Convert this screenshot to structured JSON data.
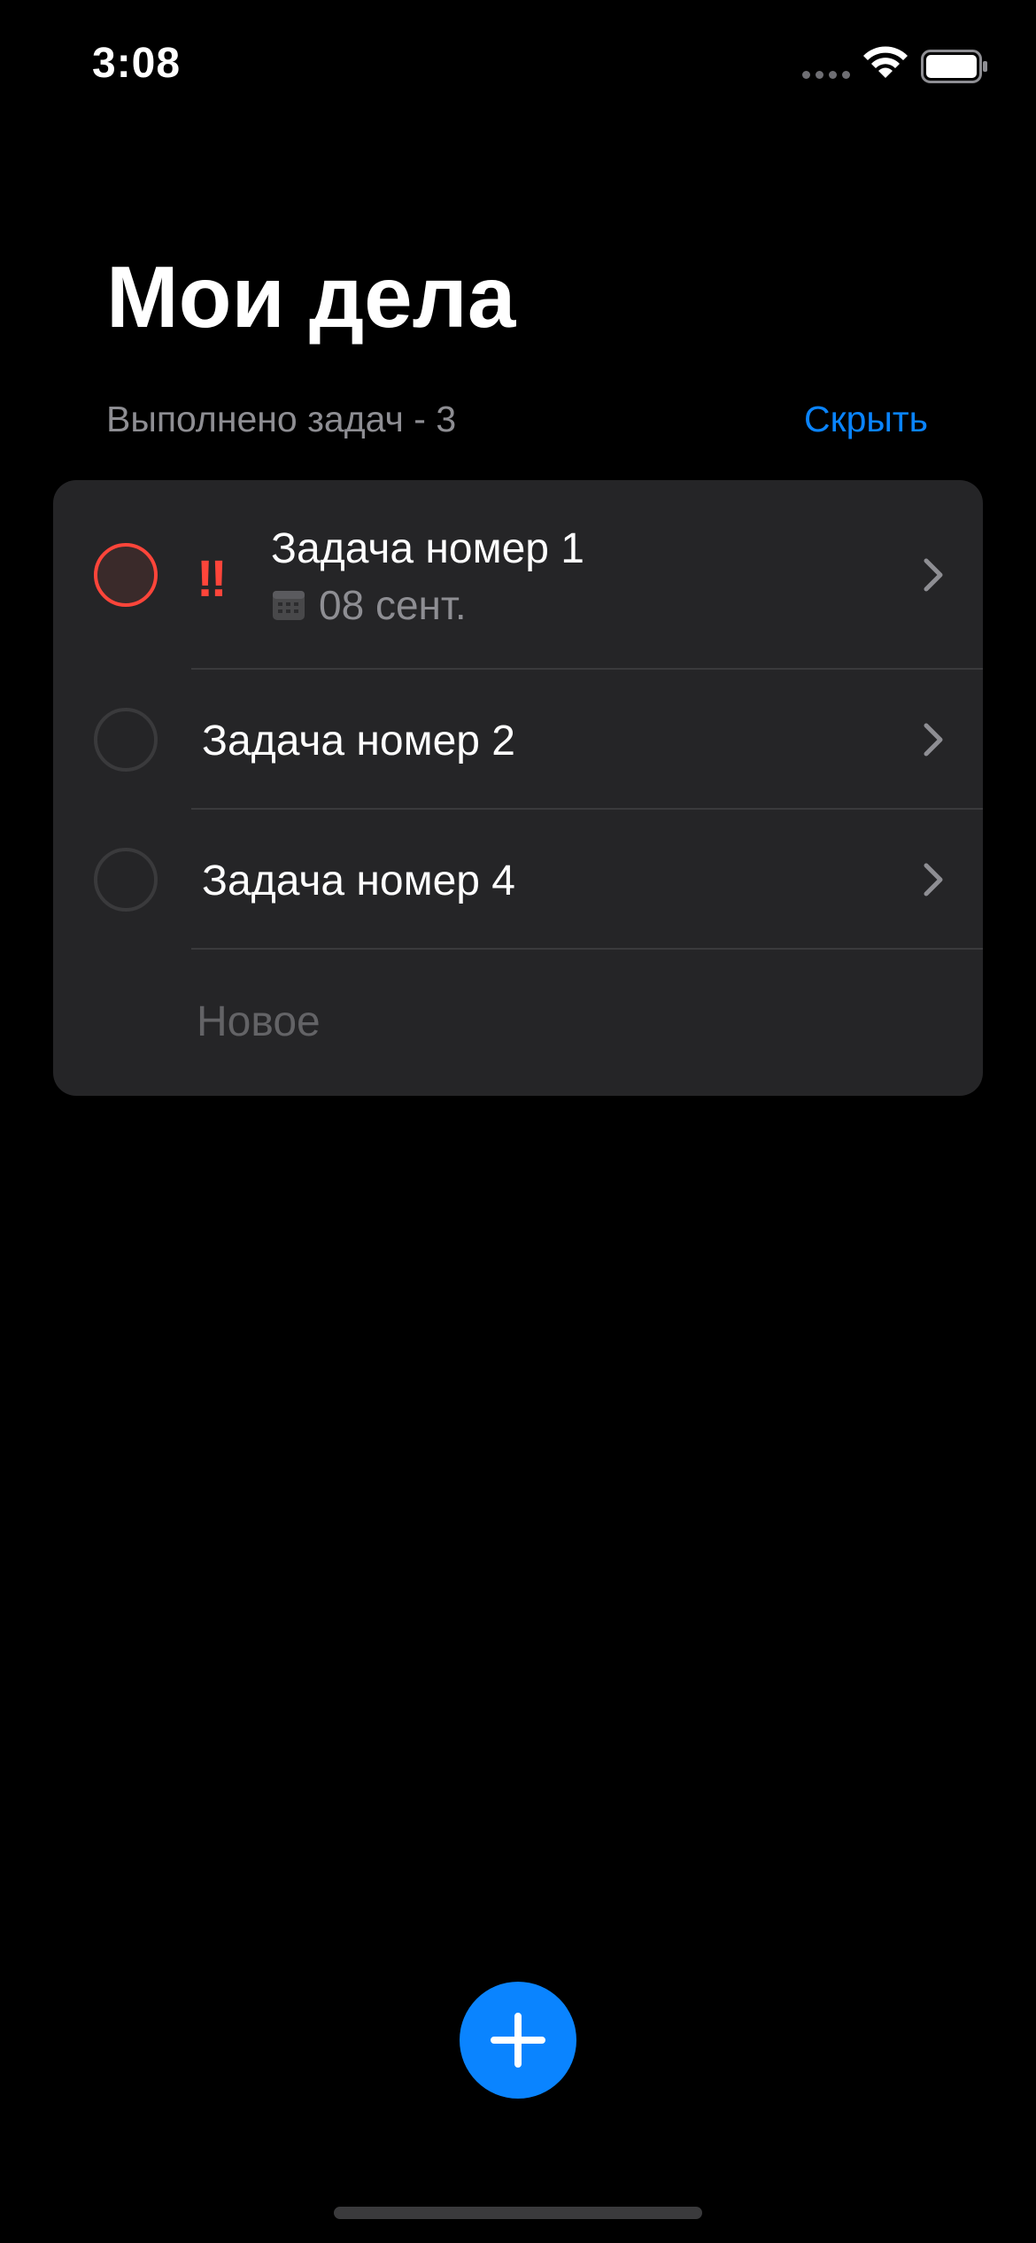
{
  "status_bar": {
    "time": "3:08",
    "icons": [
      "signal-icon",
      "wifi-icon",
      "battery-icon"
    ]
  },
  "header": {
    "title": "Мои дела",
    "done_count_label": "Выполнено задач - 3",
    "hide_label": "Скрыть"
  },
  "tasks": [
    {
      "title": "Задача номер 1",
      "priority": "!!",
      "due": "08 сент.",
      "completed": false,
      "important": true
    },
    {
      "title": "Задача номер 2",
      "completed": false
    },
    {
      "title": "Задача номер 4",
      "completed": false
    }
  ],
  "new_item": {
    "placeholder": "Новое"
  },
  "colors": {
    "background": "#000000",
    "card": "#252527",
    "accent": "#0a84ff",
    "priority": "#ff453a",
    "secondary_text": "#8e8e93"
  }
}
